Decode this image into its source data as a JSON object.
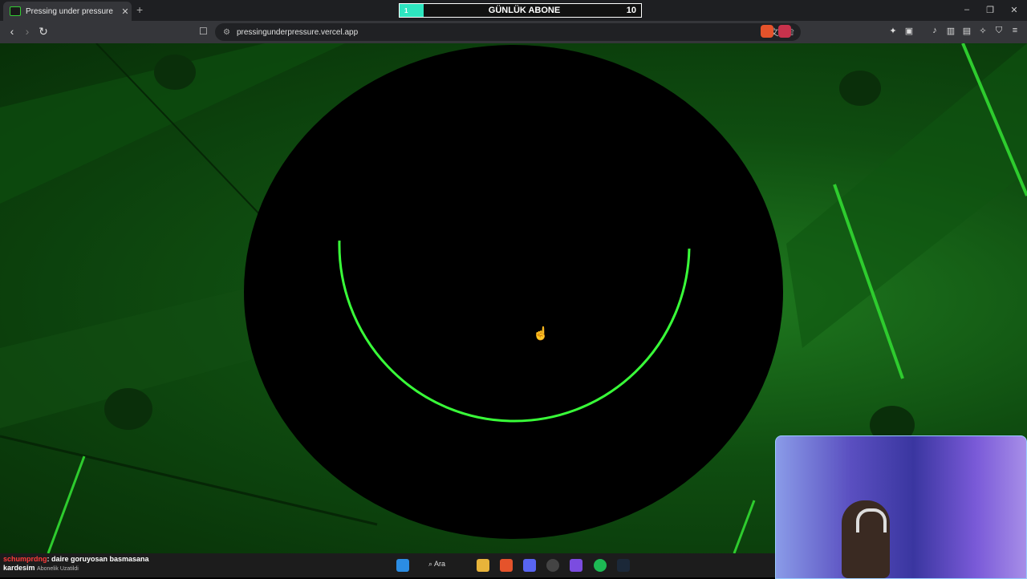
{
  "browser": {
    "tab": {
      "title": "Pressing under pressure"
    },
    "url": "pressingunderpressure.vercel.app"
  },
  "overlay": {
    "sub_counter": {
      "current": "1",
      "label": "GÜNLÜK ABONE",
      "goal": "10",
      "progress": 0.1
    }
  },
  "chat": {
    "username": "schumprdng",
    "message": ": daire goruyosan basmasana",
    "line2": "kardesim",
    "sub_text": "Abonelik Uzatildi"
  },
  "taskbar": {
    "search_label": "Ara"
  },
  "colors": {
    "accent_green": "#39ff39",
    "sub_bar_fill": "#2ee6c0"
  },
  "icons": [
    "back-icon",
    "forward-icon",
    "reload-icon",
    "bookmark-icon",
    "site-info-icon",
    "translate-icon",
    "share-icon",
    "brave-shield-icon",
    "brave-rewards-icon",
    "extensions-icon",
    "screenshot-icon",
    "media-icon",
    "sidebar-icon",
    "wallet-icon",
    "leo-icon",
    "vpn-icon",
    "menu-icon",
    "windows-start-icon",
    "search-icon",
    "file-explorer-icon",
    "brave-taskbar-icon",
    "discord-icon",
    "obs-icon",
    "steam-icon",
    "spotify-icon"
  ]
}
